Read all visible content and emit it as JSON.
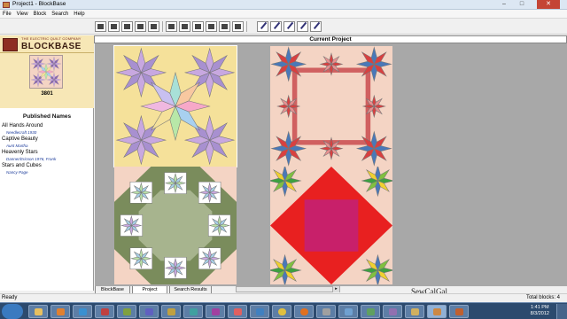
{
  "window": {
    "title": "Project1 - BlockBase",
    "min": "–",
    "max": "□",
    "close": "✕"
  },
  "menu": [
    "File",
    "View",
    "Block",
    "Search",
    "Help"
  ],
  "toolbar": {
    "count": 16
  },
  "logo": {
    "company": "THE ELECTRIC QUILT COMPANY",
    "name": "BLOCKBASE"
  },
  "selected": {
    "number": "3801"
  },
  "published_names": {
    "heading": "Published Names",
    "items": [
      {
        "name": "All Hands Around",
        "author": "Needlecraft 1930"
      },
      {
        "name": "Captive Beauty",
        "author": "Aunt Martha"
      },
      {
        "name": "Heavenly Stars",
        "author": "Danner/Ericson 1976, Frank"
      },
      {
        "name": "Stars and Cubes",
        "author": "Nancy Page"
      }
    ]
  },
  "content": {
    "heading": "Current Project"
  },
  "tabs": [
    "BlockBase",
    "Project",
    "Search Results"
  ],
  "status": {
    "left": "Ready",
    "right": "Total blocks: 4"
  },
  "watermark": "SewCalGal",
  "clock": {
    "time": "1:41 PM",
    "date": "8/3/2012"
  },
  "colors": {
    "lavender": "#c8a8e0",
    "gold": "#f5e19a",
    "peach": "#f4d4c4",
    "red": "#d84040",
    "blue": "#4a78b8",
    "olive": "#7a8c5c",
    "magenta": "#c8206a",
    "green": "#3ca040"
  }
}
